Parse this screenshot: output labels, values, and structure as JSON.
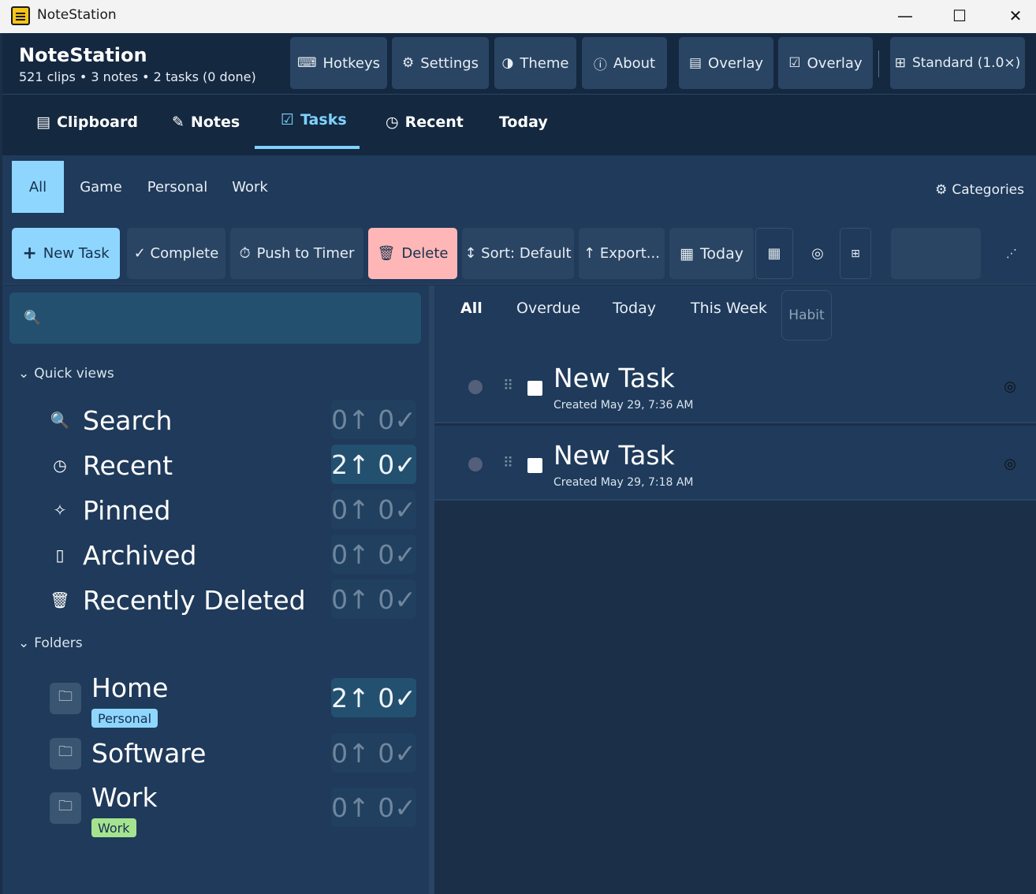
{
  "window": {
    "title": "NoteStation",
    "minimize": "—",
    "maximize": "☐",
    "close": "✕"
  },
  "header": {
    "brand": "NoteStation",
    "stats": "521 clips • 3 notes • 2 tasks (0 done)",
    "buttons": {
      "hotkeys": "Hotkeys",
      "settings": "Settings",
      "theme": "Theme",
      "about": "About",
      "overlay1": "Overlay",
      "overlay2": "Overlay",
      "standard": "Standard (1.0×)"
    }
  },
  "tabs": {
    "clipboard": "Clipboard",
    "notes": "Notes",
    "tasks": "Tasks",
    "recent": "Recent",
    "today": "Today"
  },
  "categories": {
    "all": "All",
    "game": "Game",
    "personal": "Personal",
    "work": "Work",
    "manage": "Categories"
  },
  "toolbar": {
    "new_task": "New Task",
    "complete": "✓ Complete",
    "push_timer": "Push to Timer",
    "delete": "Delete",
    "sort": "↕ Sort: Default",
    "export": "↑ Export...",
    "today": "Today"
  },
  "sidebar": {
    "search_placeholder": "",
    "quick_views_label": "Quick views",
    "quick_views": [
      {
        "label": "Search",
        "icon": "magnifier-icon",
        "badge": "0↑ 0✓",
        "active": false
      },
      {
        "label": "Recent",
        "icon": "clock-icon",
        "badge": "2↑ 0✓",
        "active": true
      },
      {
        "label": "Pinned",
        "icon": "pin-icon",
        "badge": "0↑ 0✓",
        "active": false
      },
      {
        "label": "Archived",
        "icon": "archive-icon",
        "badge": "0↑ 0✓",
        "active": false
      },
      {
        "label": "Recently Deleted",
        "icon": "trash-icon",
        "badge": "0↑ 0✓",
        "active": false
      }
    ],
    "folders_label": "Folders",
    "folders": [
      {
        "name": "Home",
        "tag": "Personal",
        "badge": "2↑ 0✓"
      },
      {
        "name": "Software",
        "tag": "",
        "badge": "0↑ 0✓"
      },
      {
        "name": "Work",
        "tag": "Work",
        "badge": "0↑ 0✓"
      }
    ]
  },
  "filters": {
    "all": "All",
    "overdue": "Overdue",
    "today": "Today",
    "this_week": "This Week",
    "habit": "Habit"
  },
  "tasks": [
    {
      "title": "New Task",
      "created": "Created May 29, 7:36 AM"
    },
    {
      "title": "New Task",
      "created": "Created May 29, 7:18 AM"
    }
  ],
  "colors": {
    "accent": "#8fd6ff",
    "danger": "#ffb6b6",
    "background": "#1b2f48"
  }
}
